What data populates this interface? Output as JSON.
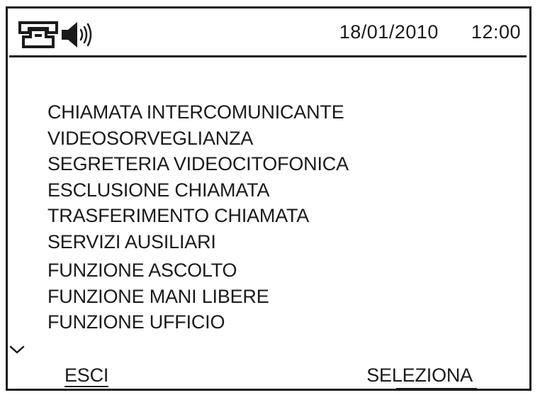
{
  "status": {
    "date": "18/01/2010",
    "time": "12:00",
    "icons": [
      "intercom-handset-icon",
      "speaker-volume-icon"
    ]
  },
  "menu": {
    "items": [
      "CHIAMATA INTERCOMUNICANTE",
      "VIDEOSORVEGLIANZA",
      "SEGRETERIA VIDEOCITOFONICA",
      "ESCLUSIONE CHIAMATA",
      "TRASFERIMENTO CHIAMATA",
      "SERVIZI AUSILIARI",
      "FUNZIONE ASCOLTO",
      "FUNZIONE MANI LIBERE",
      "FUNZIONE UFFICIO"
    ],
    "scroll_indicator": "chevron-down-icon"
  },
  "softkeys": {
    "left": "ESCI",
    "right": "SELEZIONA"
  }
}
